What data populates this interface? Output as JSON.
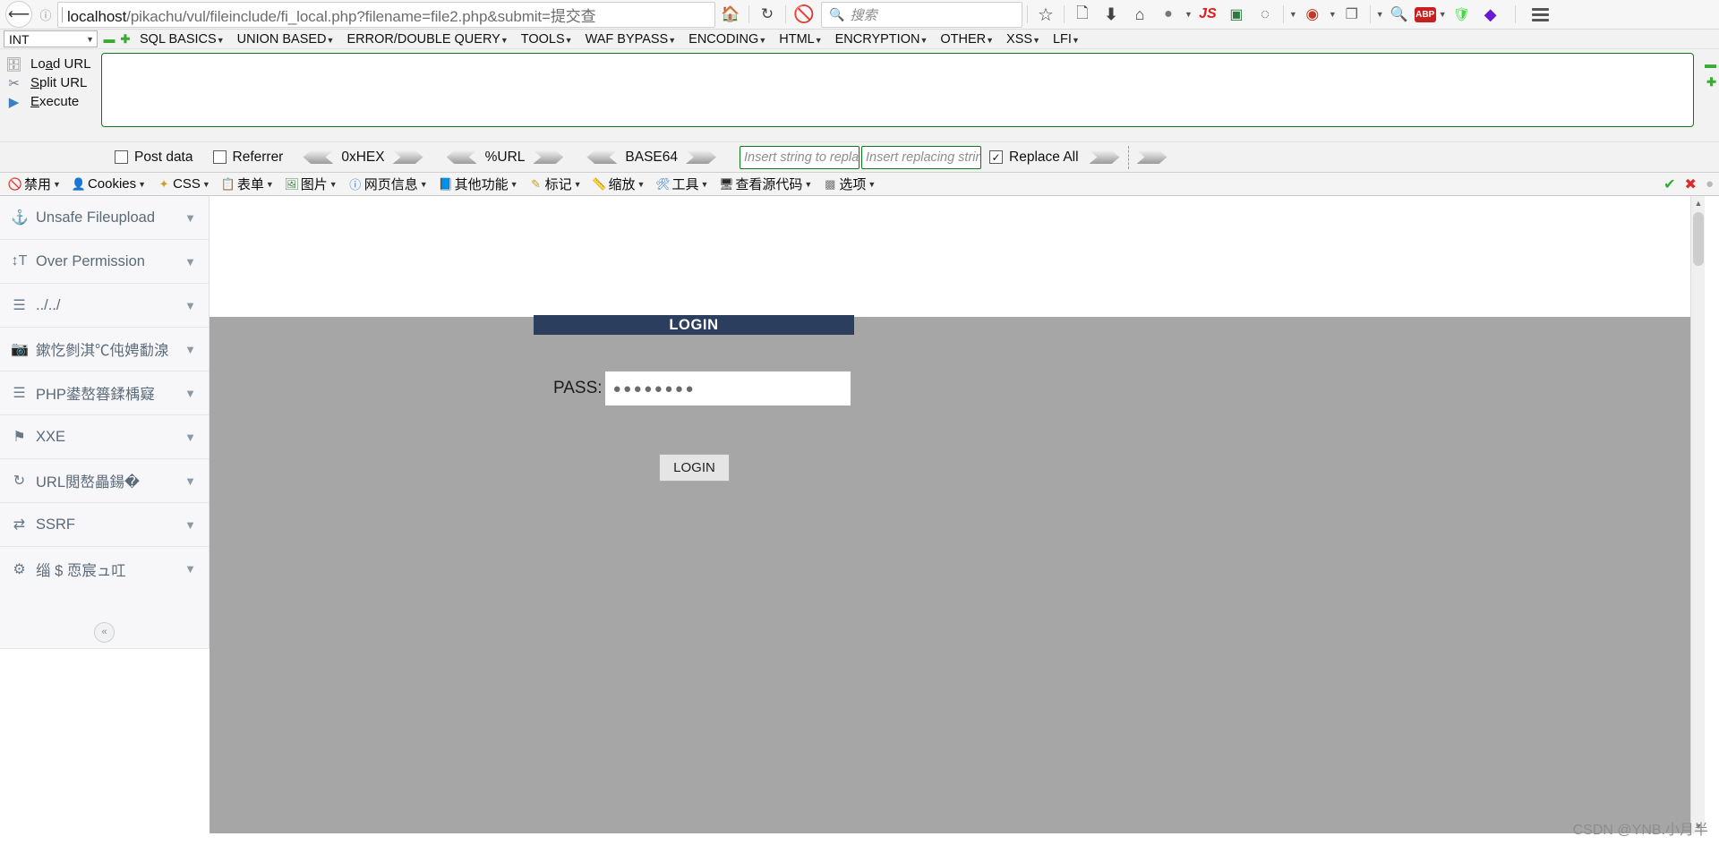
{
  "browser": {
    "back_icon": "back-arrow-icon",
    "info_icon": "page-info-icon",
    "url": "localhost/pikachu/vul/fileinclude/fi_local.php?filename=file2.php&submit=提交查",
    "url_host": "localhost",
    "url_path": "/pikachu/vul/fileinclude/fi_local.php?filename=file2.php&submit=提交查",
    "home_icon": "home-icon",
    "reload_icon": "reload-icon",
    "noscript_icon": "noscript-blocked-icon",
    "search_placeholder": "搜索",
    "search_icon": "search-icon",
    "toolbar_icons": [
      {
        "name": "bookmark-star-icon",
        "glyph": "☆"
      },
      {
        "name": "reader-list-icon",
        "glyph": "Ὕ2"
      },
      {
        "name": "downloads-icon",
        "glyph": "↓"
      },
      {
        "name": "home-icon",
        "glyph": "⌂"
      },
      {
        "name": "firebug-icon",
        "glyph": "●"
      },
      {
        "name": "javascript-toggle-icon",
        "glyph": "JS"
      },
      {
        "name": "image-export-icon",
        "glyph": "▣"
      },
      {
        "name": "cookie-manager-icon",
        "glyph": "◍"
      },
      {
        "name": "hackbar-icon",
        "glyph": "◉"
      },
      {
        "name": "page-copy-icon",
        "glyph": "❐"
      },
      {
        "name": "magnifier-icon",
        "glyph": "ὐD"
      },
      {
        "name": "adblock-plus-icon",
        "glyph": "ABP"
      },
      {
        "name": "web-of-trust-icon",
        "glyph": "W"
      },
      {
        "name": "violentmonkey-icon",
        "glyph": "◆"
      }
    ],
    "menu_icon": "hamburger-menu-icon"
  },
  "hackbar": {
    "type_select": "INT",
    "minus_label": "–",
    "plus_label": "+",
    "menus": [
      "SQL BASICS",
      "UNION BASED",
      "ERROR/DOUBLE QUERY",
      "TOOLS",
      "WAF BYPASS",
      "ENCODING",
      "HTML",
      "ENCRYPTION",
      "OTHER",
      "XSS",
      "LFI"
    ],
    "actions": [
      {
        "icon": "load-url-icon",
        "label": "Load URL",
        "accesskey": "a"
      },
      {
        "icon": "split-url-icon",
        "label": "Split URL",
        "accesskey": "S"
      },
      {
        "icon": "execute-icon",
        "label": "Execute",
        "accesskey": "E"
      }
    ],
    "textarea_value": "",
    "options": {
      "post_data": {
        "label": "Post data",
        "checked": false
      },
      "referrer": {
        "label": "Referrer",
        "checked": false
      },
      "encoders": [
        "0xHEX",
        "%URL",
        "BASE64"
      ],
      "replace_search_placeholder": "Insert string to replace",
      "replace_with_placeholder": "Insert replacing string",
      "replace_all": {
        "label": "Replace All",
        "checked": true
      }
    }
  },
  "devbar": {
    "items": [
      {
        "label": "禁用",
        "icon": "disable-icon"
      },
      {
        "label": "Cookies",
        "icon": "cookies-icon"
      },
      {
        "label": "CSS",
        "icon": "css-icon"
      },
      {
        "label": "表单",
        "icon": "forms-icon"
      },
      {
        "label": "图片",
        "icon": "images-icon"
      },
      {
        "label": "网页信息",
        "icon": "page-info-icon"
      },
      {
        "label": "其他功能",
        "icon": "misc-icon"
      },
      {
        "label": "标记",
        "icon": "outline-icon"
      },
      {
        "label": "缩放",
        "icon": "resize-icon"
      },
      {
        "label": "工具",
        "icon": "tools-icon"
      },
      {
        "label": "查看源代码",
        "icon": "view-source-icon"
      },
      {
        "label": "选项",
        "icon": "options-icon"
      }
    ],
    "status_icons": [
      {
        "name": "validation-pass-icon",
        "glyph": "✔",
        "color": "#2fae2f"
      },
      {
        "name": "validation-error-icon",
        "glyph": "✖",
        "color": "#d92b2b"
      },
      {
        "name": "validation-neutral-icon",
        "glyph": "●",
        "color": "#b8b8b8"
      }
    ]
  },
  "sidebar": {
    "items": [
      {
        "label": "Unsafe Fileupload",
        "icon": "upload-icon",
        "chevron": "chevron-down-icon"
      },
      {
        "label": "Over Permission",
        "icon": "permission-icon",
        "chevron": "chevron-down-icon"
      },
      {
        "label": "../../",
        "icon": "directory-traversal-icon",
        "chevron": "chevron-down-icon"
      },
      {
        "label": "鏉忔剼淇℃伅娉勫湶",
        "icon": "camera-icon",
        "chevron": "chevron-down-icon"
      },
      {
        "label": "PHP鍙嶅簭鍒楀寲",
        "icon": "list-icon",
        "chevron": "chevron-down-icon"
      },
      {
        "label": "XXE",
        "icon": "flag-icon",
        "chevron": "chevron-down-icon"
      },
      {
        "label": "URL閲嶅畾鍚�",
        "icon": "redirect-icon",
        "chevron": "chevron-down-icon"
      },
      {
        "label": "SSRF",
        "icon": "ssrf-icon",
        "chevron": "chevron-down-icon"
      },
      {
        "label": "缁 $ 恧宸ュ叿",
        "icon": "gear-icon",
        "chevron": "chevron-down-icon"
      }
    ],
    "collapse_icon": "collapse-sidebar-icon",
    "collapse_glyph": "«"
  },
  "login_page": {
    "header": "LOGIN",
    "pass_label": "PASS:",
    "pass_value": "●●●●●●●●",
    "submit_label": "LOGIN",
    "colors": {
      "header_bg": "#2c3e5d",
      "page_bg": "#a6a6a6",
      "button_bg": "#e5e5e5"
    }
  },
  "watermark": "CSDN @YNB.小月半"
}
